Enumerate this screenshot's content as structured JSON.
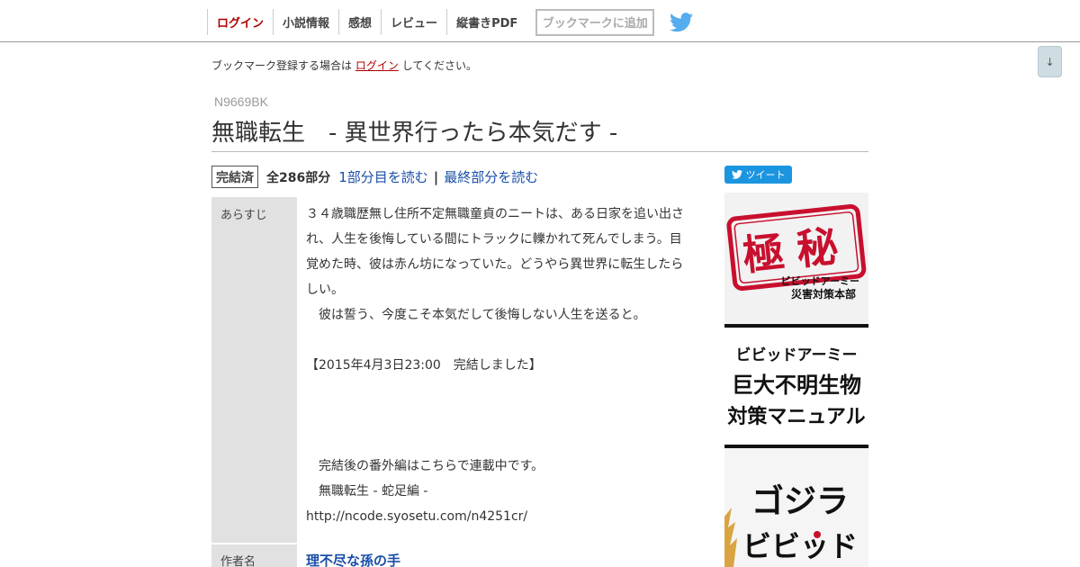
{
  "nav": {
    "login": "ログイン",
    "novel_info": "小説情報",
    "impressions": "感想",
    "review": "レビュー",
    "vertical_pdf": "縦書きPDF",
    "add_bookmark": "ブックマークに追加",
    "twitter_icon": "twitter-bird-icon"
  },
  "scroll_down": "↓",
  "bookmark_notice": {
    "prefix": "ブックマーク登録する場合は",
    "login_link": "ログイン",
    "suffix": "してください。"
  },
  "novel": {
    "ncode": "N9669BK",
    "title": "無職転生　- 異世界行ったら本気だす -",
    "status": "完結済",
    "episode_count": "全286部分",
    "read_first": "1部分目を読む",
    "separator": "|",
    "read_last": "最終部分を読む"
  },
  "summary": {
    "label": "あらすじ",
    "lines": [
      "３４歳職歴無し住所不定無職童貞のニートは、ある日家を追い出さ",
      "れ、人生を後悔している間にトラックに轢かれて死んでしまう。目",
      "覚めた時、彼は赤ん坊になっていた。どうやら異世界に転生したら",
      "しい。",
      "　彼は誓う、今度こそ本気だして後悔しない人生を送ると。",
      "",
      "【2015年4月3日23:00　完結しました】",
      "",
      "",
      "",
      "　完結後の番外編はこちらで連載中です。",
      "　無職転生 - 蛇足編 -",
      "http://ncode.syosetu.com/n4251cr/"
    ]
  },
  "author": {
    "label": "作者名",
    "name": "理不尽な孫の手"
  },
  "tweet": {
    "label": "ツイート",
    "icon": "twitter-bird-icon"
  },
  "ad": {
    "stamp_text": "極秘",
    "stamp_sub1": "ビビッドアーミー",
    "stamp_sub2": "災害対策本部",
    "line1": "ビビッドアーミー",
    "line2": "巨大不明生物",
    "line3": "対策マニュアル",
    "godzilla": "ゴジラ",
    "vivid_partial": "ビビッド"
  },
  "colors": {
    "login_red": "#b00000",
    "link_blue": "#1a4ea8",
    "twitter_blue": "#1b95e0",
    "label_gray": "#e1e1e1",
    "stamp_red": "#c8102e"
  }
}
